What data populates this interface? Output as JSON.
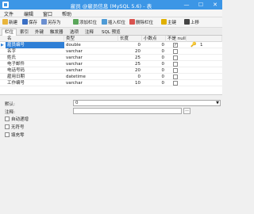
{
  "window": {
    "title": "雇员 @雇员信息 (MySQL 5.6) - 表",
    "minimize_glyph": "—",
    "maximize_glyph": "☐",
    "close_glyph": "✕"
  },
  "menu": [
    "文件",
    "编辑",
    "窗口",
    "帮助"
  ],
  "toolbar": {
    "new_label": "新建",
    "save_label": "保存",
    "save_as_label": "另存为",
    "add_field_label": "添加栏位",
    "insert_field_label": "插入栏位",
    "delete_field_label": "删除栏位",
    "primary_key_label": "主键",
    "move_up_label": "上移"
  },
  "tabs": [
    "栏位",
    "索引",
    "外键",
    "触发器",
    "选项",
    "注释",
    "SQL 预览"
  ],
  "grid": {
    "headers": [
      "名",
      "类型",
      "长度",
      "小数点",
      "不是 null",
      ""
    ],
    "rows": [
      {
        "name": "雇员编号",
        "type": "double",
        "length": "0",
        "decimals": "0",
        "not_null": true,
        "key": "1"
      },
      {
        "name": "名字",
        "type": "varchar",
        "length": "20",
        "decimals": "0",
        "not_null": false,
        "key": ""
      },
      {
        "name": "姓氏",
        "type": "varchar",
        "length": "25",
        "decimals": "0",
        "not_null": false,
        "key": ""
      },
      {
        "name": "电子邮件",
        "type": "varchar",
        "length": "25",
        "decimals": "0",
        "not_null": false,
        "key": ""
      },
      {
        "name": "电话号码",
        "type": "varchar",
        "length": "20",
        "decimals": "0",
        "not_null": false,
        "key": ""
      },
      {
        "name": "雇用日期",
        "type": "datetime",
        "length": "0",
        "decimals": "0",
        "not_null": false,
        "key": ""
      },
      {
        "name": "工作编号",
        "type": "varchar",
        "length": "10",
        "decimals": "0",
        "not_null": false,
        "key": ""
      }
    ]
  },
  "properties": {
    "default_label": "默认:",
    "default_value": "0",
    "comment_label": "注释:",
    "comment_value": "",
    "ellipsis": "...",
    "auto_increment_label": "自动递增",
    "unsigned_label": "无符号",
    "zerofill_label": "填充零"
  }
}
